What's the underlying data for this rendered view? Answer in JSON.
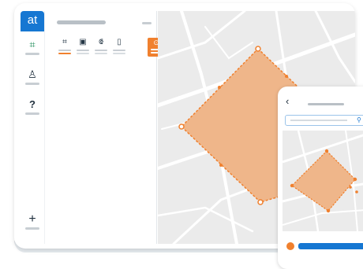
{
  "app": {
    "logo_text": "at"
  },
  "rail": {
    "items": [
      {
        "name": "polygon-tool-icon",
        "glyph": "⌗",
        "active": true
      },
      {
        "name": "user-icon",
        "glyph": "♙",
        "active": false
      },
      {
        "name": "help-icon",
        "glyph": "?",
        "active": false
      },
      {
        "name": "add-icon",
        "glyph": "+",
        "active": false
      }
    ]
  },
  "toolbar": {
    "tools": [
      {
        "name": "draw-polygon-tool",
        "glyph": "⌗",
        "selected": true
      },
      {
        "name": "draw-rectangle-tool",
        "glyph": "▣",
        "selected": false
      },
      {
        "name": "draw-line-tool",
        "glyph": "⟃",
        "selected": false
      },
      {
        "name": "draw-shape-tool",
        "glyph": "▯",
        "selected": false
      },
      {
        "name": "save-tool",
        "glyph": "⊙",
        "selected": false,
        "highlighted": true
      }
    ]
  },
  "phone": {
    "back_glyph": "‹",
    "search_icon": "⚲"
  },
  "colors": {
    "brand_blue": "#1677d2",
    "accent_orange": "#f0802e",
    "polygon_fill": "#efb68a",
    "map_bg": "#ebebeb",
    "road": "#ffffff"
  }
}
